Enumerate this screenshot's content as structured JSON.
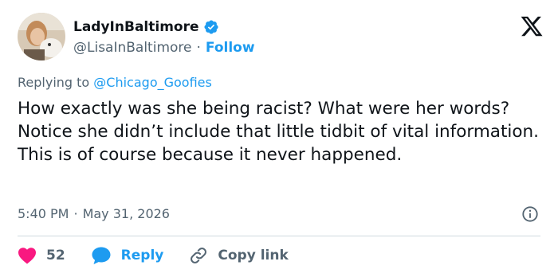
{
  "author": {
    "display_name": "LadyInBaltimore",
    "handle": "@LisaInBaltimore",
    "separator": "·",
    "follow_label": "Follow"
  },
  "replying": {
    "prefix": "Replying to",
    "mention": "@Chicago_Goofies"
  },
  "tweet": {
    "text": "How exactly was she being racist? What were her words? Notice she didn’t include that little tidbit of vital information. This is of course because it never happened."
  },
  "meta": {
    "time": "5:40 PM",
    "separator": "·",
    "date": "May 31, 2026"
  },
  "actions": {
    "like_count": "52",
    "reply_label": "Reply",
    "copy_label": "Copy link"
  },
  "icons": {
    "platform_logo": "x-logo-icon",
    "verified": "verified-badge-icon",
    "info": "info-icon",
    "like": "heart-icon",
    "reply": "reply-bubble-icon",
    "copy": "link-icon"
  },
  "colors": {
    "accent": "#1d9bf0",
    "heart": "#f91880",
    "text": "#0f1419",
    "muted": "#536471"
  }
}
